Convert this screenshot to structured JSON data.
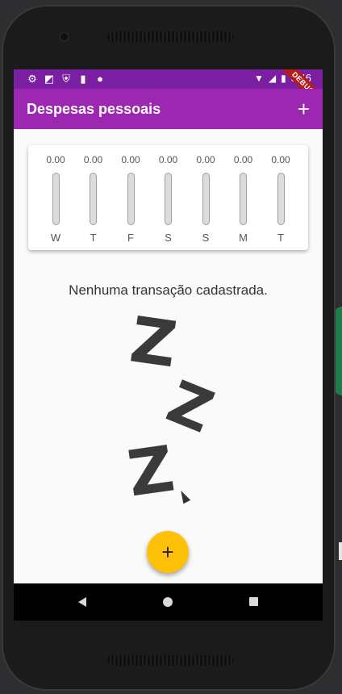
{
  "status_bar": {
    "left_icons": [
      "gear-icon",
      "a-icon",
      "shield-icon",
      "sd-card-icon",
      "circle-icon"
    ],
    "time": "3:46",
    "debug_label": "DEBUG"
  },
  "app_bar": {
    "title": "Despesas pessoais",
    "add_icon": "+"
  },
  "chart_data": {
    "type": "bar",
    "categories": [
      "W",
      "T",
      "F",
      "S",
      "S",
      "M",
      "T"
    ],
    "values": [
      0.0,
      0.0,
      0.0,
      0.0,
      0.0,
      0.0,
      0.0
    ],
    "value_labels": [
      "0.00",
      "0.00",
      "0.00",
      "0.00",
      "0.00",
      "0.00",
      "0.00"
    ],
    "fill_fraction": [
      0,
      0,
      0,
      0,
      0,
      0,
      0
    ]
  },
  "empty_state": {
    "message": "Nenhuma transação cadastrada.",
    "z_letters": [
      "Z",
      "Z",
      "Z"
    ]
  },
  "fab": {
    "icon": "+"
  },
  "colors": {
    "primary": "#9c27b0",
    "primary_dark": "#7b1fa2",
    "accent": "#ffc107"
  }
}
